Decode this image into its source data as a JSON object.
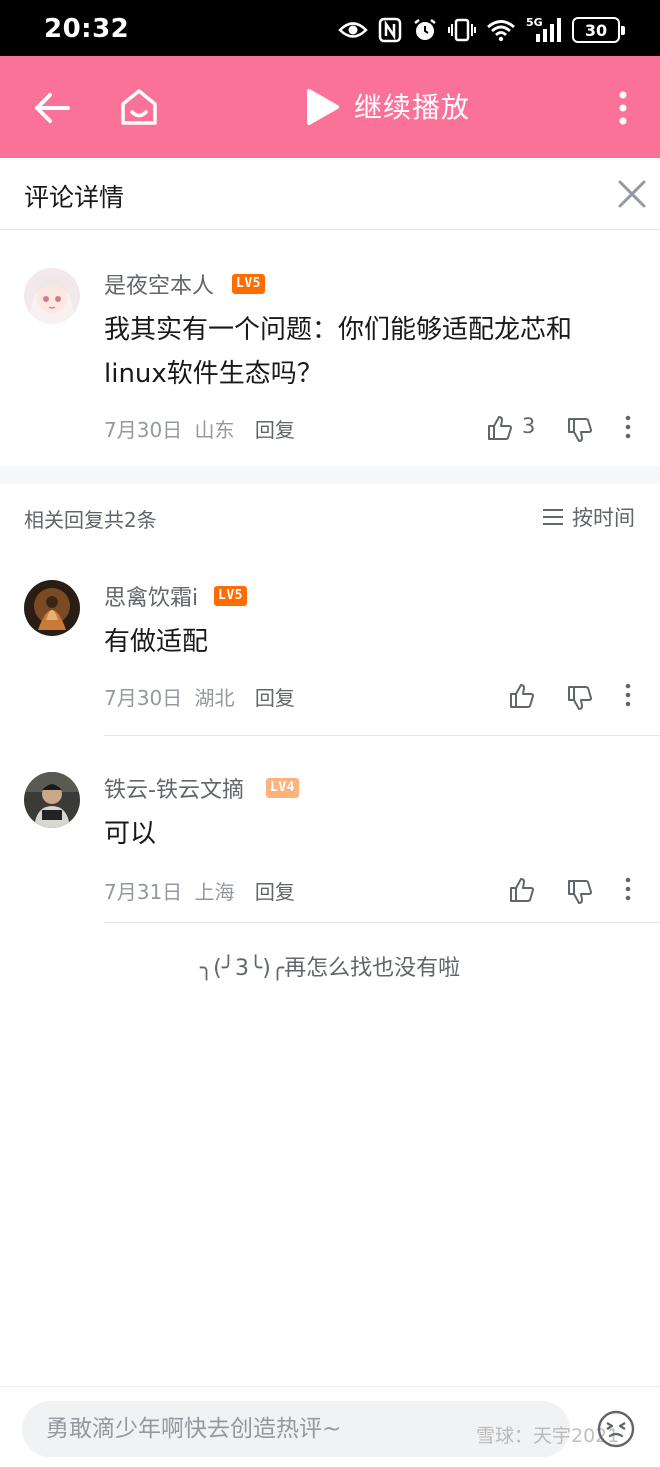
{
  "status_bar": {
    "time": "20:32",
    "battery": "30",
    "network": "5G"
  },
  "top_bar": {
    "resume_label": "继续播放",
    "color": "#fb7299"
  },
  "detail": {
    "title": "评论详情"
  },
  "root_comment": {
    "username": "是夜空本人",
    "level": "LV5",
    "content_line1": "我其实有一个问题：你们能够适配龙芯和",
    "content_line2": "linux软件生态吗？",
    "date": "7月30日",
    "location": "山东",
    "reply_label": "回复",
    "likes": "3"
  },
  "replies_header": {
    "count_label": "相关回复共2条",
    "sort_label": "按时间"
  },
  "replies": [
    {
      "username": "思禽饮霜i",
      "level": "LV5",
      "content": "有做适配",
      "date": "7月30日",
      "location": "湖北",
      "reply_label": "回复"
    },
    {
      "username": "铁云-铁云文摘",
      "level": "LV4",
      "content": "可以",
      "date": "7月31日",
      "location": "上海",
      "reply_label": "回复"
    }
  ],
  "no_more": "╮(╯3╰)╭再怎么找也没有啦",
  "bottom": {
    "placeholder": "勇敢滴少年啊快去创造热评~",
    "watermark": "雪球：天宇2021"
  },
  "colors": {
    "lv5": "#ff6c00",
    "lv4": "#ffb37c",
    "accent": "#fb7299"
  }
}
